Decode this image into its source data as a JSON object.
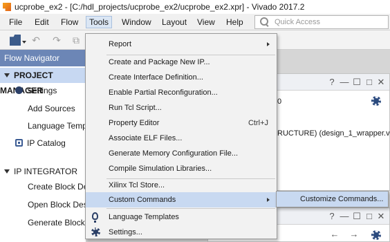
{
  "window": {
    "title": "ucprobe_ex2 - [C:/hdl_projects/ucprobe_ex2/ucprobe_ex2.xpr] - Vivado 2017.2"
  },
  "menubar": {
    "items": [
      "File",
      "Edit",
      "Flow",
      "Tools",
      "Window",
      "Layout",
      "View",
      "Help"
    ],
    "active": "Tools"
  },
  "quick_access": {
    "placeholder": "Quick Access"
  },
  "toolbar": {
    "icons": [
      "open-project-icon",
      "undo-icon",
      "redo-icon",
      "copy-icon"
    ]
  },
  "flow_navigator": {
    "title": "Flow Navigator",
    "sections": [
      {
        "label": "PROJECT MANAGER",
        "items": [
          "Settings",
          "Add Sources",
          "Language Templ",
          "IP Catalog"
        ]
      },
      {
        "label": "IP INTEGRATOR",
        "items": [
          "Create Block Des",
          "Open Block Desig",
          "Generate Block D"
        ]
      }
    ]
  },
  "background_panel": {
    "partial_0": "0",
    "partial_text": "RUCTURE) (design_1_wrapper.vh"
  },
  "tools_menu": {
    "items": [
      {
        "label": "Report",
        "submenu": true
      },
      {
        "label": "Create and Package New IP..."
      },
      {
        "label": "Create Interface Definition..."
      },
      {
        "label": "Enable Partial Reconfiguration..."
      },
      {
        "label": "Run Tcl Script..."
      },
      {
        "label": "Property Editor",
        "shortcut": "Ctrl+J"
      },
      {
        "label": "Associate ELF Files..."
      },
      {
        "label": "Generate Memory Configuration File..."
      },
      {
        "label": "Compile Simulation Libraries..."
      },
      {
        "label": "Xilinx Tcl Store..."
      },
      {
        "label": "Custom Commands",
        "submenu": true,
        "highlighted": true
      },
      {
        "label": "Language Templates",
        "icon": "lightbulb-icon"
      },
      {
        "label": "Settings...",
        "icon": "gear-icon"
      }
    ]
  },
  "custom_commands_submenu": {
    "items": [
      {
        "label": "Customize Commands..."
      }
    ]
  },
  "colors": {
    "flow_nav_header": "#6c86b6",
    "selection": "#c8d9f1",
    "menu_bg": "#f2f2f2"
  }
}
